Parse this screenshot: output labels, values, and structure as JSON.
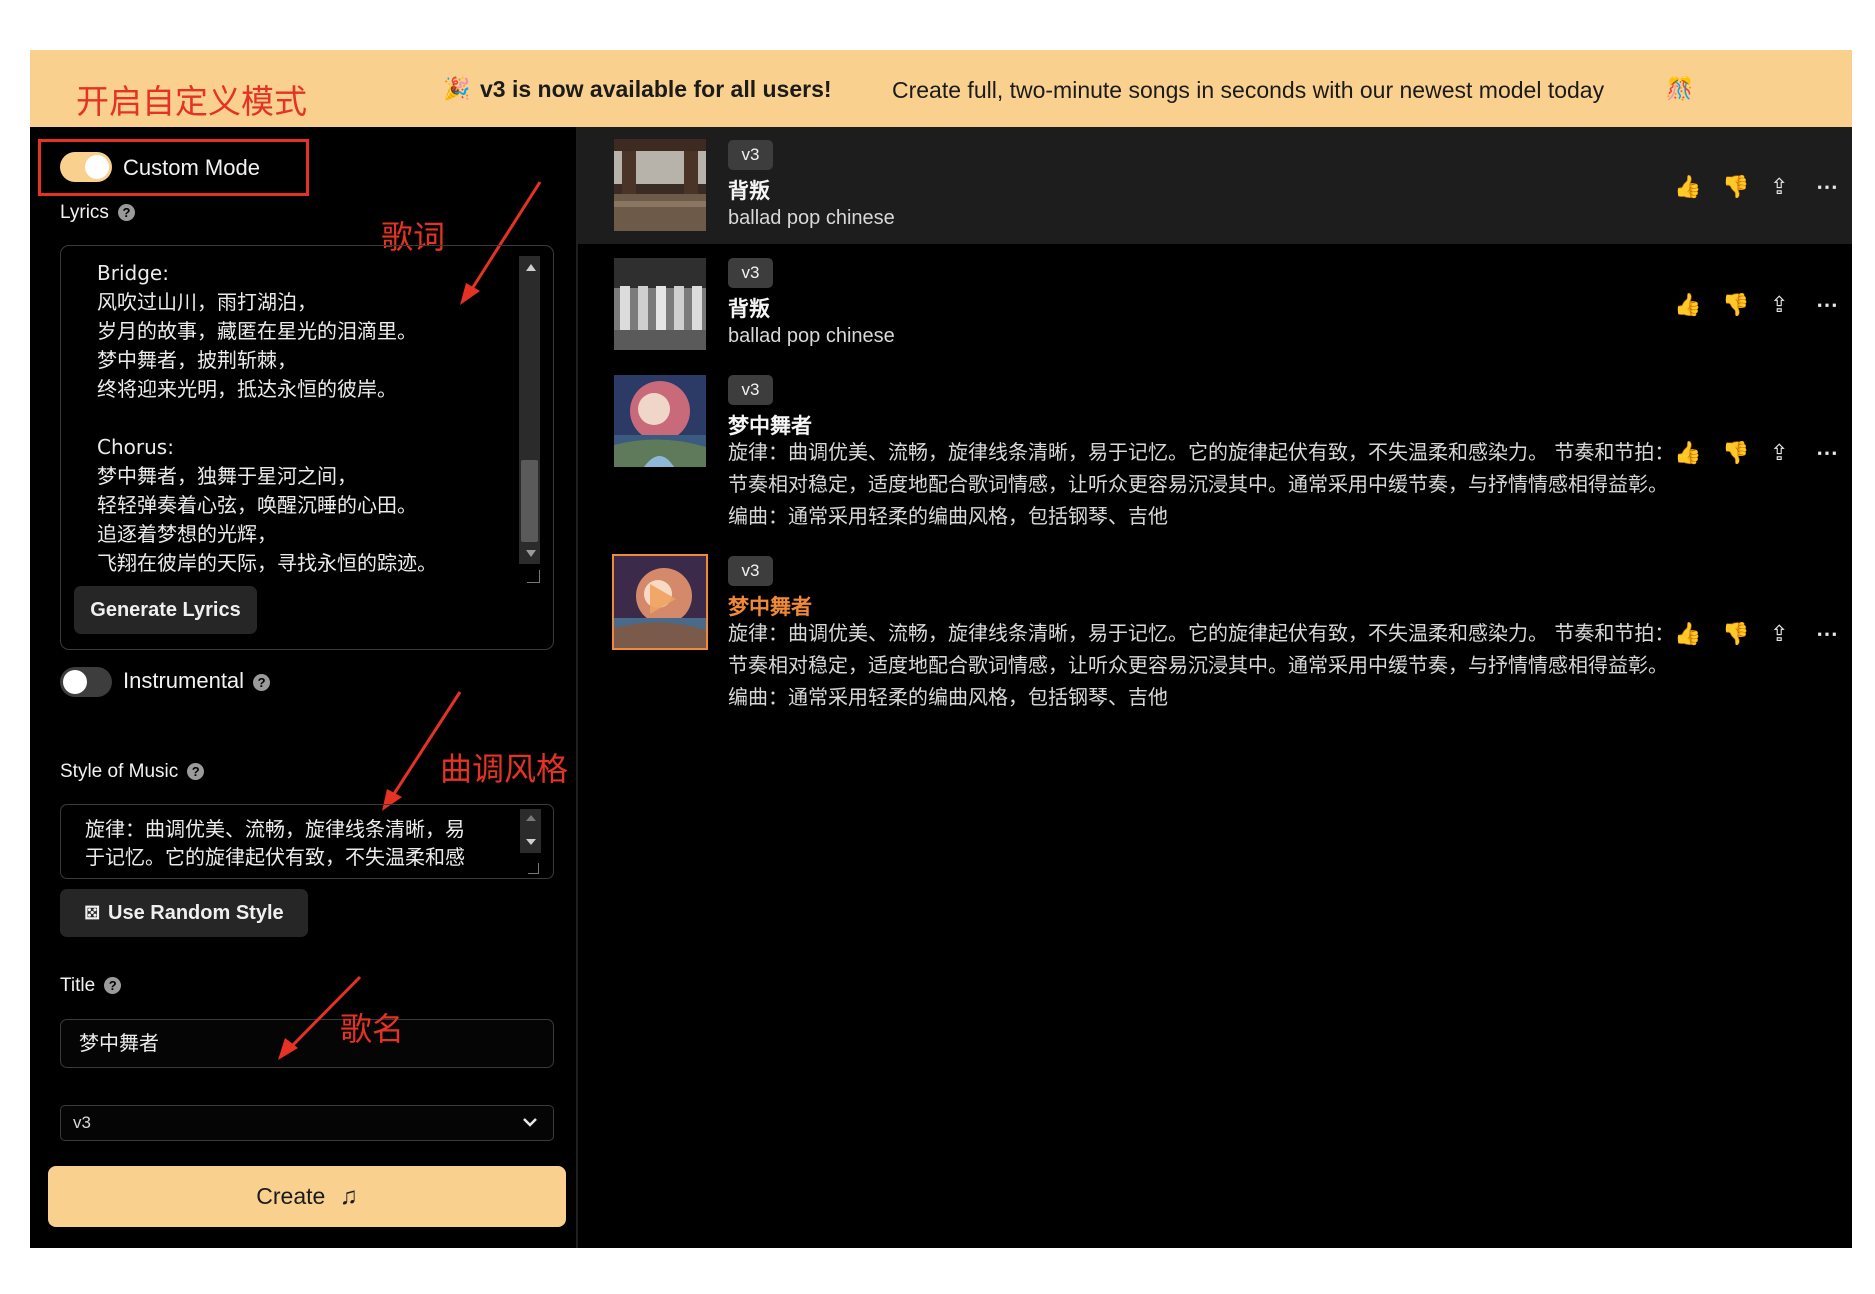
{
  "banner": {
    "party_icon": "🎉",
    "headline": "v3 is now available for all users!",
    "description": "Create full, two-minute songs in seconds with our newest model today",
    "party_icon_2": "🎊"
  },
  "annotations": {
    "custom_mode": "开启自定义模式",
    "lyrics": "歌词",
    "style": "曲调风格",
    "title": "歌名"
  },
  "form": {
    "custom_mode_label": "Custom Mode",
    "custom_mode_on": true,
    "lyrics_label": "Lyrics",
    "lyrics_text": "Bridge:\n风吹过山川，雨打湖泊，\n岁月的故事，藏匿在星光的泪滴里。\n梦中舞者，披荆斩棘，\n终将迎来光明，抵达永恒的彼岸。\n\nChorus:\n梦中舞者，独舞于星河之间，\n轻轻弹奏着心弦，唤醒沉睡的心田。\n追逐着梦想的光辉，\n飞翔在彼岸的天际，寻找永恒的踪迹。",
    "generate_lyrics_label": "Generate Lyrics",
    "instrumental_label": "Instrumental",
    "instrumental_on": false,
    "style_label": "Style of Music",
    "style_text": "旋律：曲调优美、流畅，旋律线条清晰，易于记忆。它的旋律起伏有致，不失温柔和感",
    "random_style_label": "Use Random Style",
    "title_label": "Title",
    "title_value": "梦中舞者",
    "model_value": "v3",
    "create_label": "Create",
    "help_glyph": "?"
  },
  "songs": [
    {
      "version": "v3",
      "title": "背叛",
      "desc": "ballad pop chinese",
      "highlight": false,
      "active": true
    },
    {
      "version": "v3",
      "title": "背叛",
      "desc": "ballad pop chinese",
      "highlight": false,
      "active": false
    },
    {
      "version": "v3",
      "title": "梦中舞者",
      "desc": "旋律：曲调优美、流畅，旋律线条清晰，易于记忆。它的旋律起伏有致，不失温柔和感染力。 节奏和节拍：节奏相对稳定，适度地配合歌词情感，让听众更容易沉浸其中。通常采用中缓节奏，与抒情情感相得益彰。 编曲：通常采用轻柔的编曲风格，包括钢琴、吉他",
      "highlight": false,
      "active": false
    },
    {
      "version": "v3",
      "title": "梦中舞者",
      "desc": "旋律：曲调优美、流畅，旋律线条清晰，易于记忆。它的旋律起伏有致，不失温柔和感染力。 节奏和节拍：节奏相对稳定，适度地配合歌词情感，让听众更容易沉浸其中。通常采用中缓节奏，与抒情情感相得益彰。 编曲：通常采用轻柔的编曲风格，包括钢琴、吉他",
      "highlight": true,
      "active": false
    }
  ],
  "icons": {
    "like": "thumbs-up-icon",
    "dislike": "thumbs-down-icon",
    "share": "share-icon",
    "more": "more-icon",
    "random": "dice-icon",
    "music": "music-note-icon",
    "chevron": "chevron-down-icon"
  },
  "colors": {
    "accent": "#f9d08e",
    "annotation": "#e53224",
    "highlight_title": "#f08a3a",
    "toggle_on": "#f9d08e",
    "toggle_off": "#3d3d3d"
  }
}
